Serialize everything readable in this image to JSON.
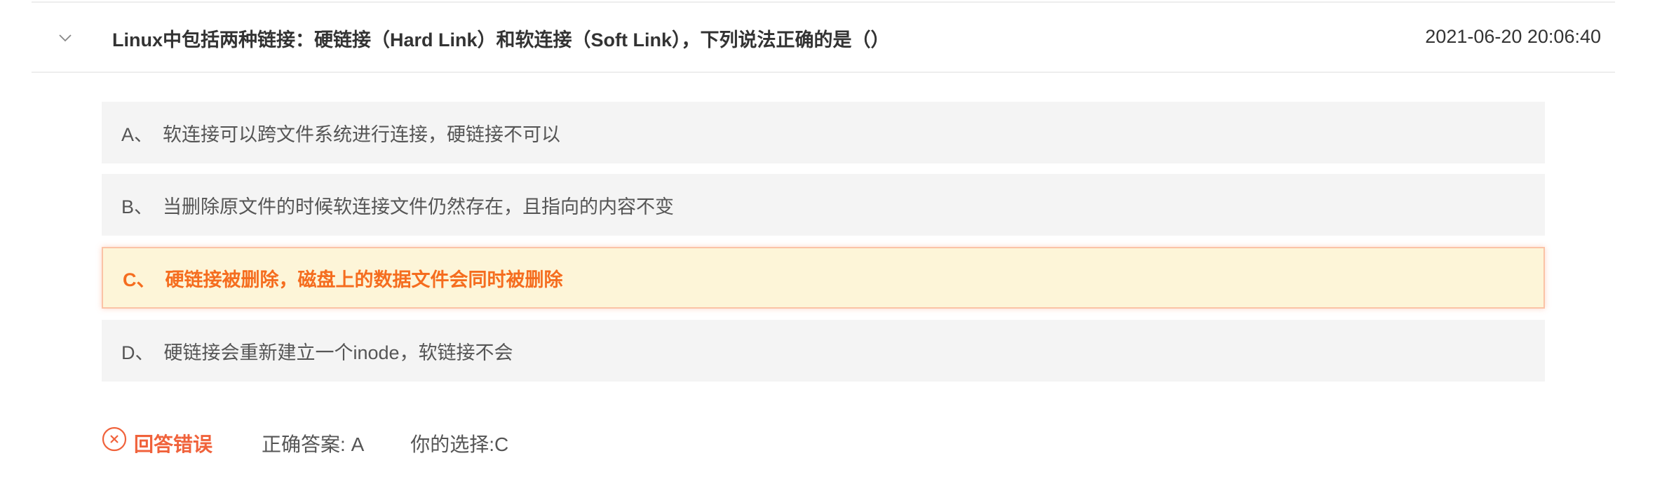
{
  "question": {
    "title": "Linux中包括两种链接：硬链接（Hard Link）和软连接（Soft Link），下列说法正确的是（）",
    "timestamp": "2021-06-20 20:06:40",
    "expand_icon": "chevron-down-icon"
  },
  "options": [
    {
      "letter": "A、",
      "text": "软连接可以跨文件系统进行连接，硬链接不可以",
      "selected": false
    },
    {
      "letter": "B、",
      "text": "当删除原文件的时候软连接文件仍然存在，且指向的内容不变",
      "selected": false
    },
    {
      "letter": "C、",
      "text": "硬链接被删除，磁盘上的数据文件会同时被删除",
      "selected": true
    },
    {
      "letter": "D、",
      "text": "硬链接会重新建立一个inode，软链接不会",
      "selected": false
    }
  ],
  "result": {
    "status_icon": "close-circle-icon",
    "status_text": "回答错误",
    "correct_answer": "正确答案: A",
    "your_choice": "你的选择:C"
  },
  "colors": {
    "selected_bg": "#fdf5d8",
    "selected_text": "#f56d1f",
    "error": "#f0623b",
    "option_bg": "#f4f4f4"
  }
}
